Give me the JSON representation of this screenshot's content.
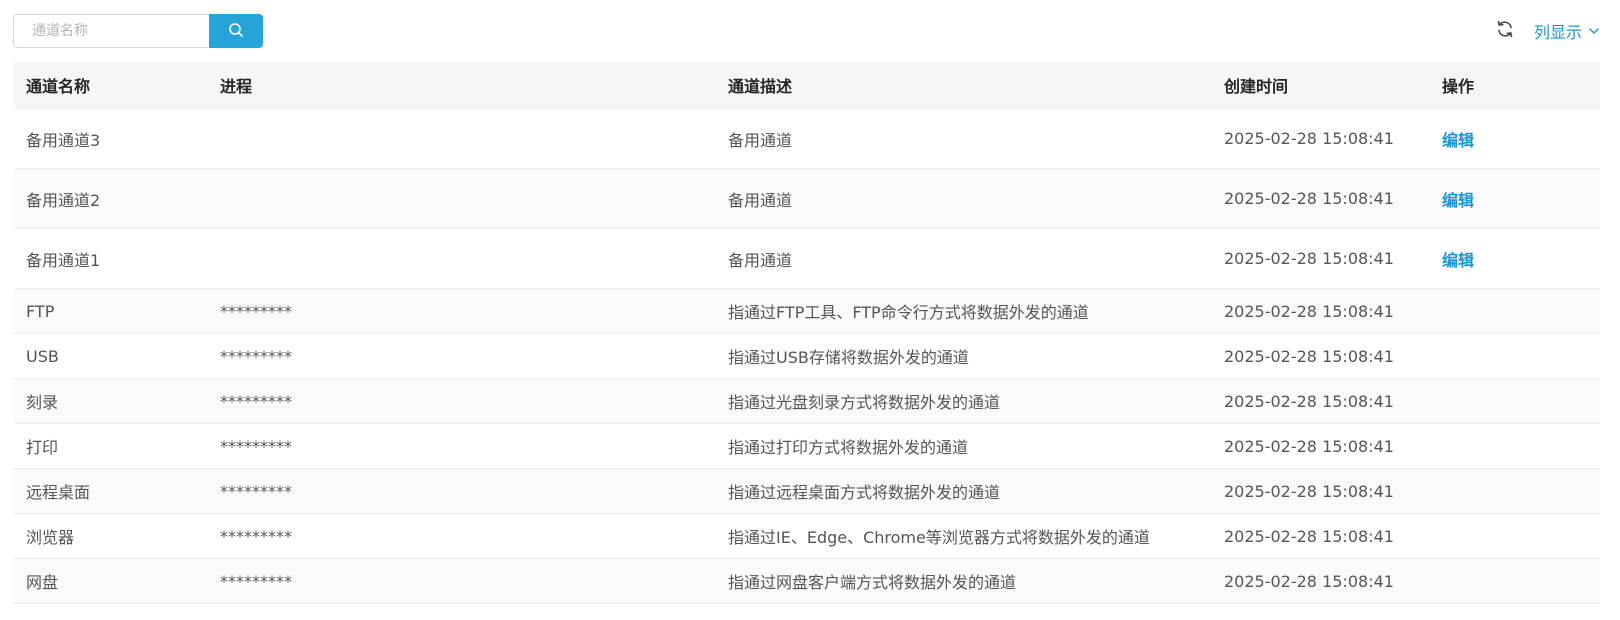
{
  "search": {
    "placeholder": "通道名称"
  },
  "toolbar": {
    "refresh_icon": "refresh-icon",
    "column_display_label": "列显示"
  },
  "colors": {
    "accent": "#26a3d9",
    "link": "#1f95d0",
    "header_bg": "#f4f6f9"
  },
  "table": {
    "headers": [
      "通道名称",
      "进程",
      "通道描述",
      "创建时间",
      "操作"
    ],
    "rows": [
      {
        "name": "备用通道3",
        "process": "",
        "desc": "备用通道",
        "time": "2025-02-28 15:08:41",
        "action": "编辑"
      },
      {
        "name": "备用通道2",
        "process": "",
        "desc": "备用通道",
        "time": "2025-02-28 15:08:41",
        "action": "编辑"
      },
      {
        "name": "备用通道1",
        "process": "",
        "desc": "备用通道",
        "time": "2025-02-28 15:08:41",
        "action": "编辑"
      },
      {
        "name": "FTP",
        "process": "*********",
        "desc": "指通过FTP工具、FTP命令行方式将数据外发的通道",
        "time": "2025-02-28 15:08:41",
        "action": ""
      },
      {
        "name": "USB",
        "process": "*********",
        "desc": "指通过USB存储将数据外发的通道",
        "time": "2025-02-28 15:08:41",
        "action": ""
      },
      {
        "name": "刻录",
        "process": "*********",
        "desc": "指通过光盘刻录方式将数据外发的通道",
        "time": "2025-02-28 15:08:41",
        "action": ""
      },
      {
        "name": "打印",
        "process": "*********",
        "desc": "指通过打印方式将数据外发的通道",
        "time": "2025-02-28 15:08:41",
        "action": ""
      },
      {
        "name": "远程桌面",
        "process": "*********",
        "desc": "指通过远程桌面方式将数据外发的通道",
        "time": "2025-02-28 15:08:41",
        "action": ""
      },
      {
        "name": "浏览器",
        "process": "*********",
        "desc": "指通过IE、Edge、Chrome等浏览器方式将数据外发的通道",
        "time": "2025-02-28 15:08:41",
        "action": ""
      },
      {
        "name": "网盘",
        "process": "*********",
        "desc": "指通过网盘客户端方式将数据外发的通道",
        "time": "2025-02-28 15:08:41",
        "action": ""
      }
    ]
  }
}
